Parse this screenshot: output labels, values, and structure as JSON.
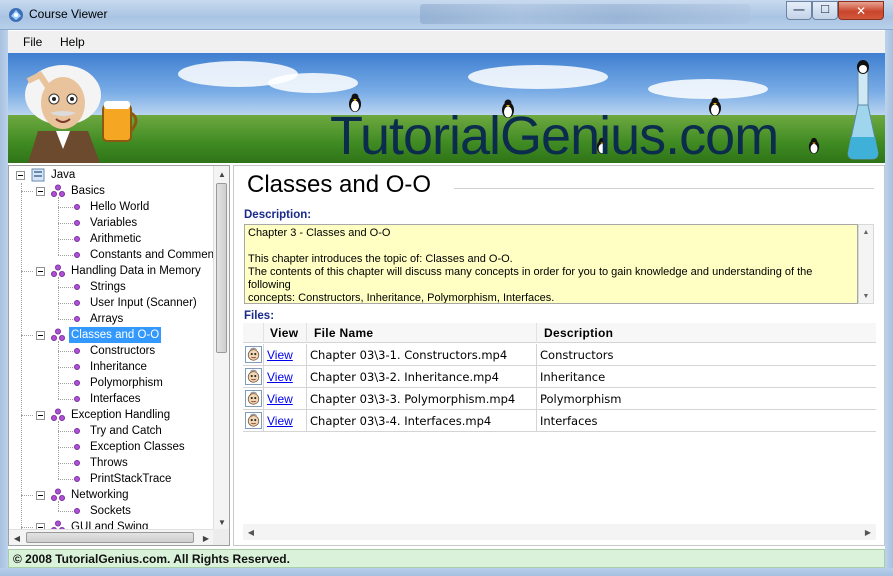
{
  "window": {
    "title": "Course Viewer",
    "minimize_glyph": "—",
    "maximize_glyph": "☐",
    "close_glyph": "✕"
  },
  "menu": {
    "file": "File",
    "help": "Help"
  },
  "banner": {
    "brand": "TutorialGenius.com"
  },
  "tree": {
    "root": "Java",
    "groups": [
      {
        "label": "Basics",
        "items": [
          "Hello World",
          "Variables",
          "Arithmetic",
          "Constants and Comments"
        ]
      },
      {
        "label": "Handling Data in Memory",
        "items": [
          "Strings",
          "User Input (Scanner)",
          "Arrays"
        ]
      },
      {
        "label": "Classes and O-O",
        "items": [
          "Constructors",
          "Inheritance",
          "Polymorphism",
          "Interfaces"
        ]
      },
      {
        "label": "Exception Handling",
        "items": [
          "Try and Catch",
          "Exception Classes",
          "Throws",
          "PrintStackTrace"
        ]
      },
      {
        "label": "Networking",
        "items": [
          "Sockets"
        ]
      },
      {
        "label": "GUI and Swing",
        "items": []
      }
    ],
    "selected": "Classes and O-O"
  },
  "content": {
    "chapter_title": "Classes and O-O",
    "description_label": "Description:",
    "description_lines": [
      "Chapter 3 - Classes and O-O",
      "",
      "This chapter introduces the topic of: Classes and O-O.",
      "The contents of this chapter will discuss many concepts in order for you to gain knowledge and understanding of the following",
      "concepts: Constructors, Inheritance, Polymorphism, Interfaces."
    ],
    "files_label": "Files:",
    "columns": {
      "view": "View",
      "file_name": "File Name",
      "description": "Description"
    },
    "files": [
      {
        "view": "View",
        "file_name": "Chapter 03\\3-1. Constructors.mp4",
        "description": "Constructors"
      },
      {
        "view": "View",
        "file_name": "Chapter 03\\3-2. Inheritance.mp4",
        "description": "Inheritance"
      },
      {
        "view": "View",
        "file_name": "Chapter 03\\3-3. Polymorphism.mp4",
        "description": "Polymorphism"
      },
      {
        "view": "View",
        "file_name": "Chapter 03\\3-4. Interfaces.mp4",
        "description": "Interfaces"
      }
    ]
  },
  "status": {
    "text": "© 2008 TutorialGenius.com. All Rights Reserved."
  },
  "colors": {
    "selection": "#3399ff",
    "description_bg": "#ffffc4",
    "status_bg": "#d9f2d9",
    "section_label": "#1a2a8a"
  },
  "icons": {
    "app": "course-viewer-icon",
    "tree_group": "node-cluster-icon",
    "tree_leaf": "leaf-dot-icon",
    "file_row": "video-file-icon"
  }
}
